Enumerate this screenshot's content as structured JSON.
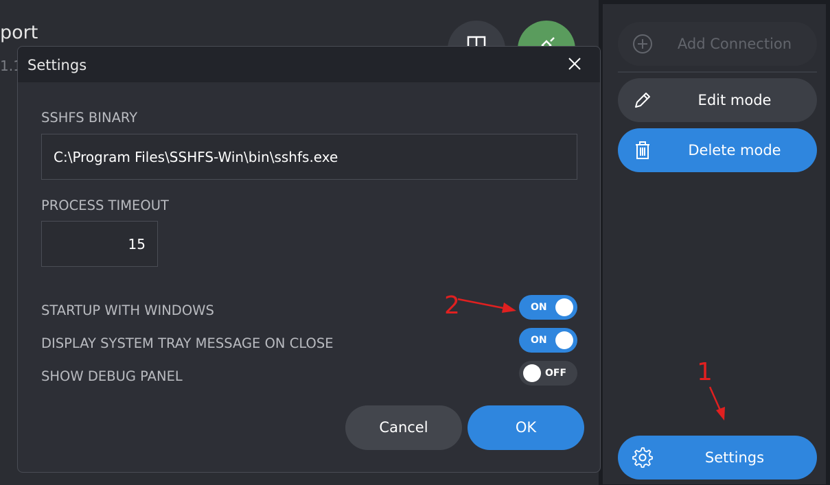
{
  "background": {
    "title": "port",
    "subtitle": "1.1"
  },
  "sidebar": {
    "add_connection": "Add Connection",
    "edit_mode": "Edit mode",
    "delete_mode": "Delete mode",
    "settings": "Settings"
  },
  "dialog": {
    "title": "Settings",
    "sshfs_binary_label": "SSHFS BINARY",
    "sshfs_binary_value": "C:\\Program Files\\SSHFS-Win\\bin\\sshfs.exe",
    "process_timeout_label": "PROCESS TIMEOUT",
    "process_timeout_value": "15",
    "toggles": [
      {
        "label": "STARTUP WITH WINDOWS",
        "state": "ON"
      },
      {
        "label": "DISPLAY SYSTEM TRAY MESSAGE ON CLOSE",
        "state": "ON"
      },
      {
        "label": "SHOW DEBUG PANEL",
        "state": "OFF"
      }
    ],
    "cancel_label": "Cancel",
    "ok_label": "OK"
  },
  "annotations": {
    "marker_1": "1",
    "marker_2": "2"
  },
  "colors": {
    "accent": "#2f86de",
    "annotation": "#e02020",
    "background": "#2b2d33",
    "connected": "#5a9c5d"
  }
}
